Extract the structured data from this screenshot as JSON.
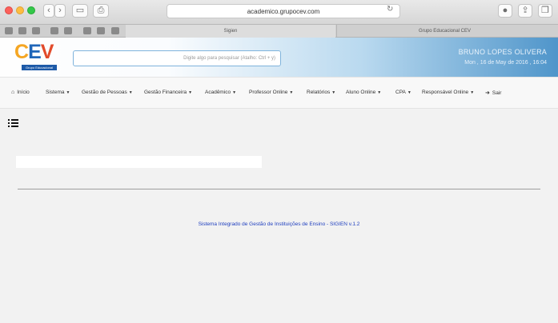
{
  "browser": {
    "url": "academico.grupocev.com",
    "tabs": [
      {
        "label": "Sigien",
        "active": true
      },
      {
        "label": "Grupo Educacional CEV",
        "active": false
      }
    ]
  },
  "header": {
    "logo_text": "CEV",
    "logo_tag": "Grupo Educacional",
    "search_placeholder": "Digite algo para pesquisar (Atalho: Ctrl + y)",
    "user_name": "BRUNO LOPES OLIVERA",
    "user_date": "Mon , 16 de May de 2016 , 16:04"
  },
  "nav": {
    "items": [
      {
        "label": "Início",
        "has_caret": false
      },
      {
        "label": "Sistema",
        "has_caret": true
      },
      {
        "label": "Gestão de Pessoas",
        "has_caret": true
      },
      {
        "label": "Gestão Financeira",
        "has_caret": true
      },
      {
        "label": "Acadêmico",
        "has_caret": true
      },
      {
        "label": "Professor Online",
        "has_caret": true
      },
      {
        "label": "Relatórios",
        "has_caret": true
      },
      {
        "label": "Aluno Online",
        "has_caret": true
      },
      {
        "label": "CPA",
        "has_caret": true
      },
      {
        "label": "Responsável Online",
        "has_caret": true
      },
      {
        "label": "Sair",
        "has_caret": false
      }
    ]
  },
  "footer": {
    "text": "Sistema Integrado de Gestão de Instituições de Ensino - SIGIEN v.1.2"
  },
  "colors": {
    "nav_bg": "#f8f8f8",
    "footer_link": "#1f3fbf",
    "header_gradient_end": "#4f95ca"
  }
}
